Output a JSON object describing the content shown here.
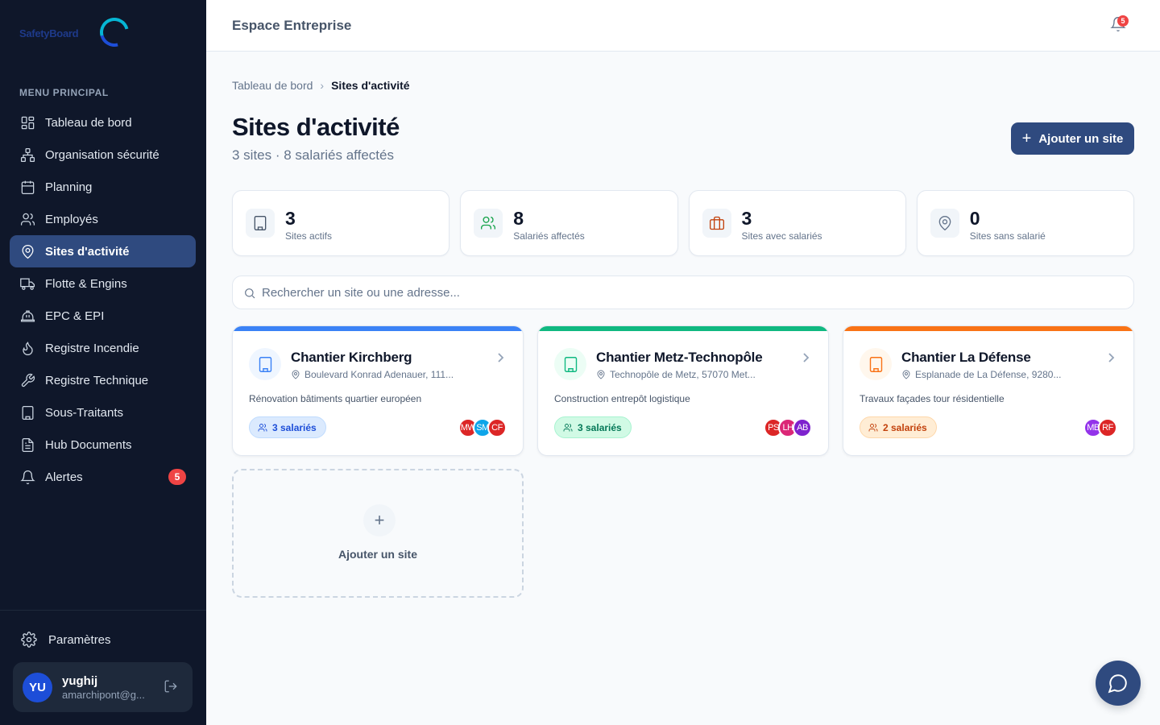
{
  "brand": {
    "logo_text": "SafetyBoard"
  },
  "sidebar": {
    "menu_title": "MENU PRINCIPAL",
    "items": [
      {
        "label": "Tableau de bord",
        "icon": "grid-icon"
      },
      {
        "label": "Organisation sécurité",
        "icon": "org-chart-icon"
      },
      {
        "label": "Planning",
        "icon": "calendar-icon"
      },
      {
        "label": "Employés",
        "icon": "users-icon"
      },
      {
        "label": "Sites d'activité",
        "icon": "map-pin-icon",
        "active": true
      },
      {
        "label": "Flotte & Engins",
        "icon": "truck-icon"
      },
      {
        "label": "EPC & EPI",
        "icon": "helmet-icon"
      },
      {
        "label": "Registre Incendie",
        "icon": "flame-icon"
      },
      {
        "label": "Registre Technique",
        "icon": "wrench-icon"
      },
      {
        "label": "Sous-Traitants",
        "icon": "building-icon"
      },
      {
        "label": "Hub Documents",
        "icon": "document-icon"
      },
      {
        "label": "Alertes",
        "icon": "bell-icon",
        "badge": "5"
      }
    ],
    "settings_label": "Paramètres",
    "user": {
      "initials": "YU",
      "name": "yughij",
      "email": "amarchipont@g..."
    }
  },
  "topbar": {
    "title": "Espace Entreprise",
    "notif_count": "5"
  },
  "breadcrumb": {
    "root": "Tableau de bord",
    "current": "Sites d'activité"
  },
  "page": {
    "title": "Sites d'activité",
    "subtitle": "3 sites · 8 salariés affectés",
    "add_button": "Ajouter un site"
  },
  "stats": [
    {
      "value": "3",
      "label": "Sites actifs",
      "icon": "building-icon",
      "color": "#475569"
    },
    {
      "value": "8",
      "label": "Salariés affectés",
      "icon": "users-icon",
      "color": "#16a34a"
    },
    {
      "value": "3",
      "label": "Sites avec salariés",
      "icon": "briefcase-icon",
      "color": "#c2410c"
    },
    {
      "value": "0",
      "label": "Sites sans salarié",
      "icon": "map-pin-icon",
      "color": "#64748b"
    }
  ],
  "search": {
    "placeholder": "Rechercher un site ou une adresse..."
  },
  "sites": [
    {
      "name": "Chantier Kirchberg",
      "address": "Boulevard Konrad Adenauer, 111...",
      "description": "Rénovation bâtiments quartier européen",
      "employees": "3 salariés",
      "accent": "#3b82f6",
      "avatars": [
        {
          "initials": "MW",
          "color": "#dc2626"
        },
        {
          "initials": "SM",
          "color": "#0ea5e9"
        },
        {
          "initials": "CF",
          "color": "#dc2626"
        }
      ]
    },
    {
      "name": "Chantier Metz-Technopôle",
      "address": "Technopôle de Metz, 57070 Met...",
      "description": "Construction entrepôt logistique",
      "employees": "3 salariés",
      "accent": "#10b981",
      "avatars": [
        {
          "initials": "PS",
          "color": "#dc2626"
        },
        {
          "initials": "LH",
          "color": "#db2777"
        },
        {
          "initials": "AB",
          "color": "#7e22ce"
        }
      ]
    },
    {
      "name": "Chantier La Défense",
      "address": "Esplanade de La Défense, 9280...",
      "description": "Travaux façades tour résidentielle",
      "employees": "2 salariés",
      "accent": "#f97316",
      "avatars": [
        {
          "initials": "MB",
          "color": "#9333ea"
        },
        {
          "initials": "RF",
          "color": "#dc2626"
        }
      ]
    }
  ],
  "add_card": {
    "label": "Ajouter un site",
    "plus": "+"
  }
}
